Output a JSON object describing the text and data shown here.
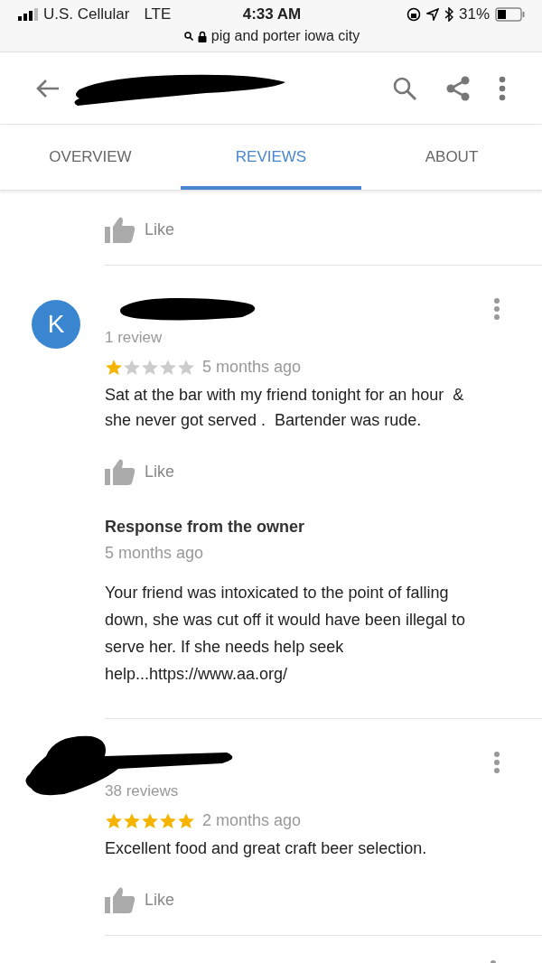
{
  "status_bar": {
    "carrier": "U.S. Cellular",
    "network": "LTE",
    "time": "4:33 AM",
    "battery": "31%",
    "url": "pig and porter iowa city"
  },
  "tabs": [
    {
      "label": "OVERVIEW",
      "selected": false
    },
    {
      "label": "REVIEWS",
      "selected": true
    },
    {
      "label": "ABOUT",
      "selected": false
    }
  ],
  "previous_review": {
    "like": "Like"
  },
  "reviews": [
    {
      "avatar_letter": "K",
      "name_redacted": true,
      "review_count": "1 review",
      "stars": 1,
      "time": "5 months ago",
      "text": "Sat at the bar with my friend tonight for an hour  & she never got served .  Bartender was rude.",
      "like": "Like",
      "owner_response": {
        "title": "Response from the owner",
        "time": "5 months ago",
        "text": "Your friend was intoxicated to the point of falling down, she was cut off it would have been illegal to serve her. If she needs help seek help...https://www.aa.org/"
      }
    },
    {
      "name_redacted": true,
      "review_count": "38 reviews",
      "stars": 5,
      "time": "2 months ago",
      "text": "Excellent food and great craft beer selection.",
      "like": "Like"
    }
  ]
}
